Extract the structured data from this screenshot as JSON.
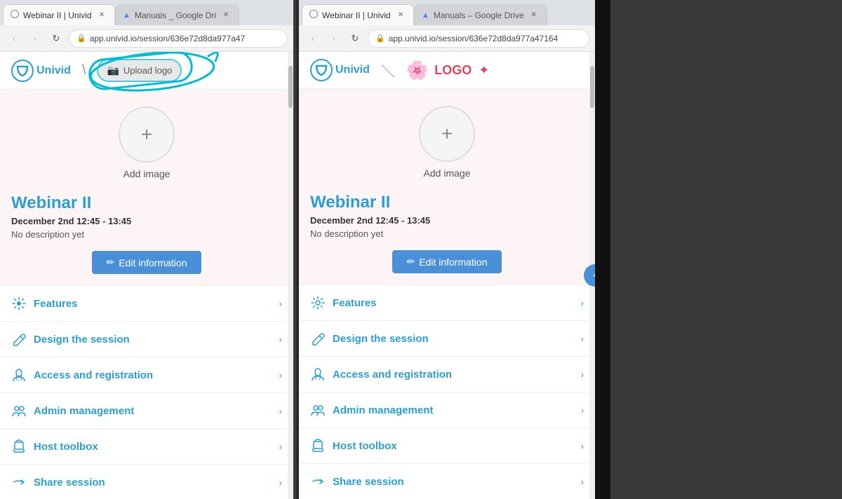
{
  "browsers": [
    {
      "id": "left",
      "tabs": [
        {
          "id": "tab-univid-left",
          "favicon": "circle",
          "title": "Webinar II | Univid",
          "active": true,
          "closable": true
        },
        {
          "id": "tab-gdrive-left",
          "favicon": "gdrive",
          "title": "Manuals _ Google Dri",
          "active": false,
          "closable": true
        }
      ],
      "url": "app.univid.io/session/636e72d8da977a47",
      "header": {
        "logo_text": "Univid",
        "separator": "\\",
        "upload_btn_label": "Upload logo",
        "has_upload": true
      },
      "webinar": {
        "add_image_label": "Add image",
        "title": "Webinar II",
        "date": "December 2nd 12:45 - 13:45",
        "description": "No description yet",
        "edit_btn": "Edit information"
      },
      "menu_items": [
        {
          "id": "features",
          "icon": "⚙",
          "label": "Features"
        },
        {
          "id": "design",
          "icon": "✏",
          "label": "Design the session"
        },
        {
          "id": "access",
          "icon": "👆",
          "label": "Access and registration"
        },
        {
          "id": "admin",
          "icon": "👥",
          "label": "Admin management"
        },
        {
          "id": "host",
          "icon": "🎒",
          "label": "Host toolbox"
        },
        {
          "id": "share",
          "icon": "↪",
          "label": "Share session"
        }
      ]
    },
    {
      "id": "right",
      "tabs": [
        {
          "id": "tab-univid-right",
          "favicon": "circle",
          "title": "Webinar II | Univid",
          "active": true,
          "closable": true
        },
        {
          "id": "tab-gdrive-right",
          "favicon": "gdrive",
          "title": "Manuals – Google Drive",
          "active": false,
          "closable": true
        }
      ],
      "url": "app.univid.io/session/636e72d8da977a47164",
      "header": {
        "logo_text": "Univid",
        "separator": "\\",
        "has_upload": false,
        "logo_word": "LOGO"
      },
      "webinar": {
        "add_image_label": "Add image",
        "title": "Webinar II",
        "date": "December 2nd 12:45 - 13:45",
        "description": "No description yet",
        "edit_btn": "Edit information"
      },
      "menu_items": [
        {
          "id": "features",
          "icon": "⚙",
          "label": "Features"
        },
        {
          "id": "design",
          "icon": "✏",
          "label": "Design the session"
        },
        {
          "id": "access",
          "icon": "👆",
          "label": "Access and registration"
        },
        {
          "id": "admin",
          "icon": "👥",
          "label": "Admin management"
        },
        {
          "id": "host",
          "icon": "🎒",
          "label": "Host toolbox"
        },
        {
          "id": "share",
          "icon": "↪",
          "label": "Share session"
        }
      ]
    }
  ],
  "colors": {
    "blue": "#2a9fd6",
    "dark_divider": "#3a3a3a",
    "accent_btn": "#4a90d9"
  }
}
